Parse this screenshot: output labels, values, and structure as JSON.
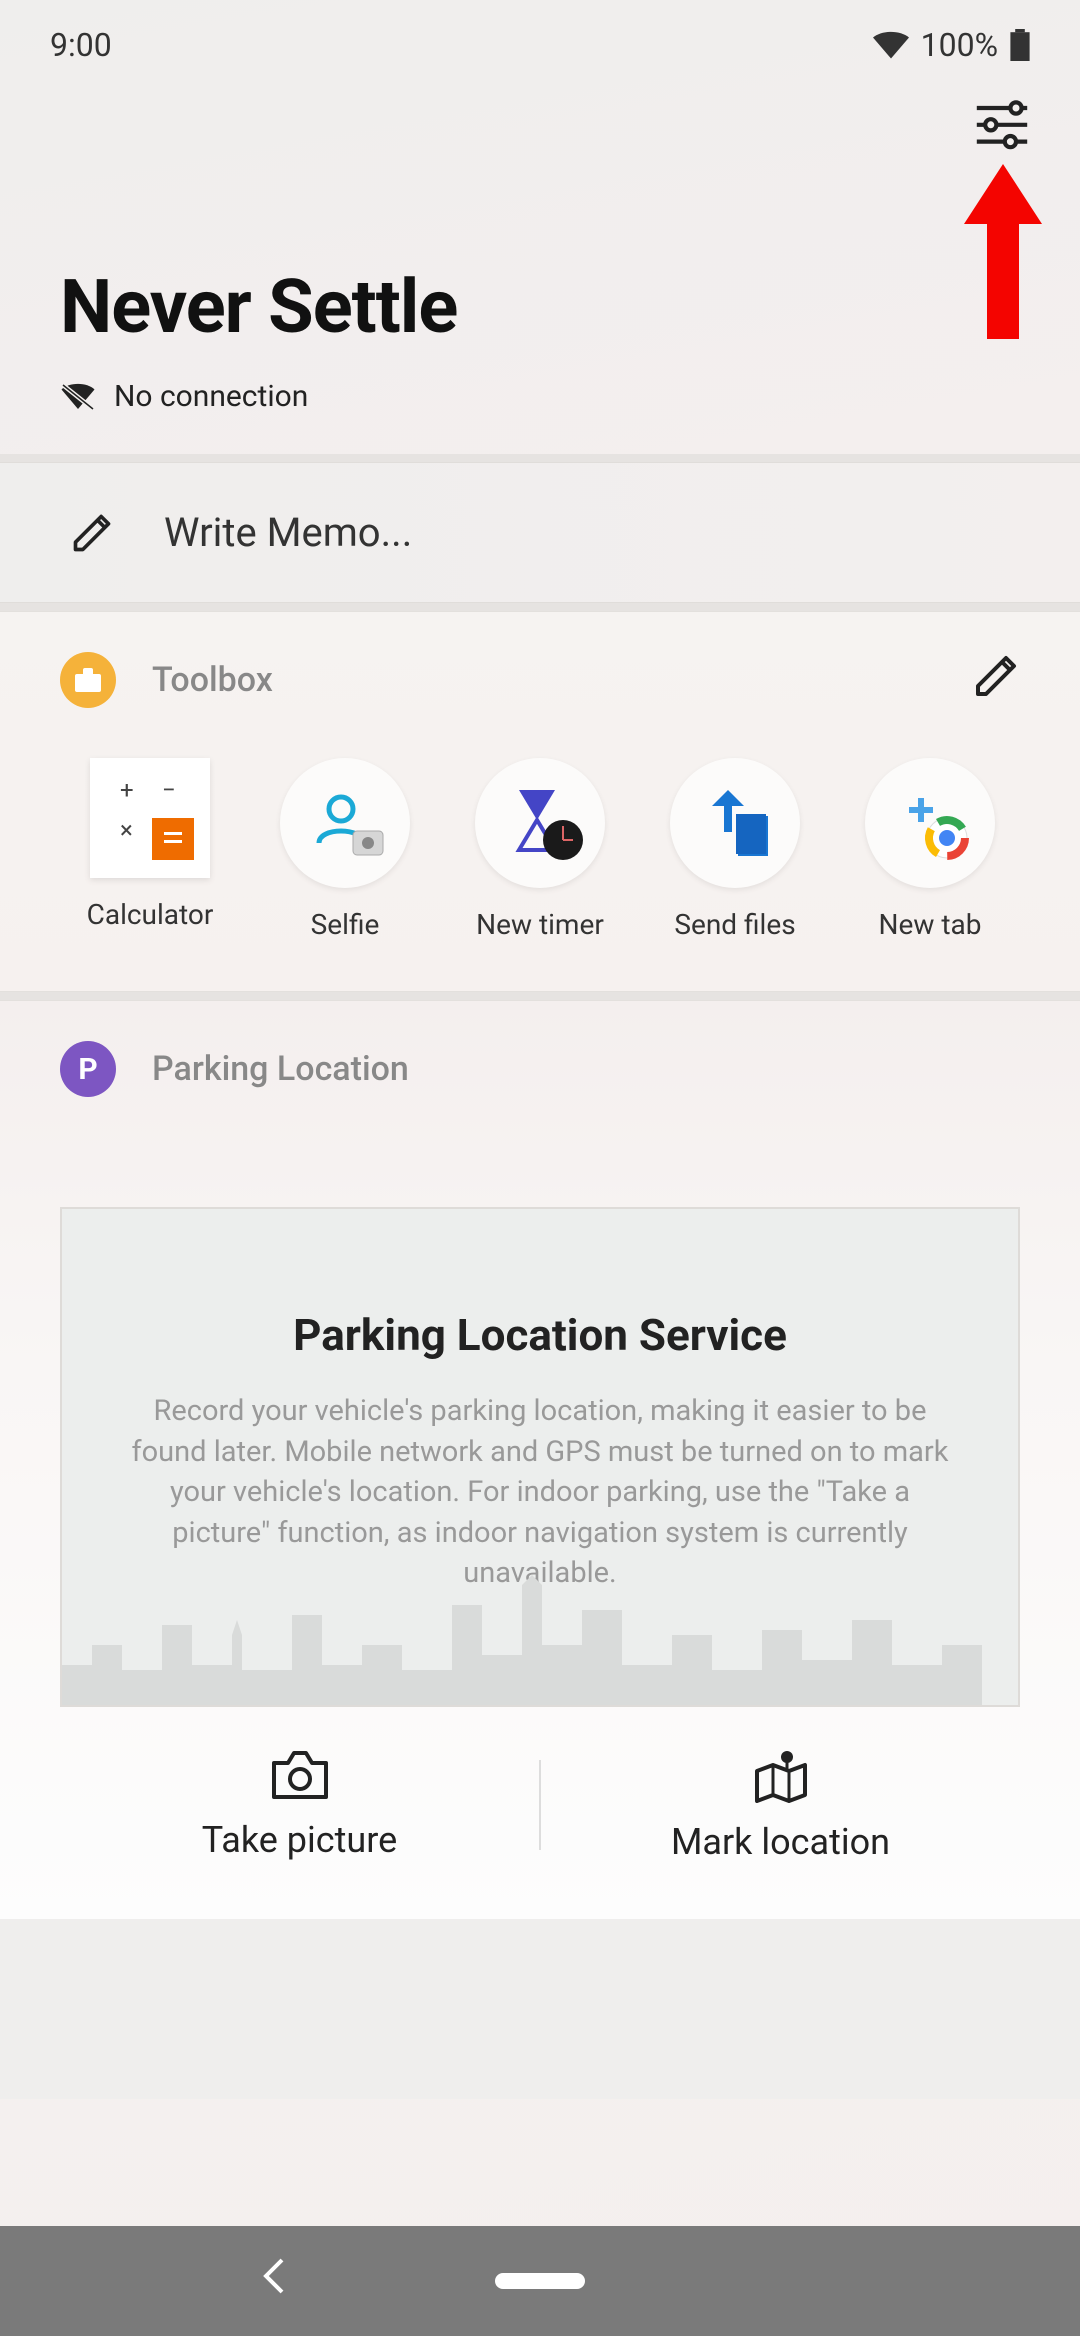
{
  "status": {
    "time": "9:00",
    "battery": "100%"
  },
  "header": {
    "title": "Never Settle",
    "connection": "No connection"
  },
  "memo": {
    "placeholder": "Write Memo..."
  },
  "toolbox": {
    "title": "Toolbox",
    "items": [
      {
        "label": "Calculator"
      },
      {
        "label": "Selfie"
      },
      {
        "label": "New timer"
      },
      {
        "label": "Send files"
      },
      {
        "label": "New tab"
      }
    ]
  },
  "parking": {
    "section_title": "Parking Location",
    "badge_letter": "P",
    "card_title": "Parking Location Service",
    "description": "Record your vehicle's parking location, making it easier to be found later. Mobile network and GPS must be turned on to mark your vehicle's location. For indoor parking, use the \"Take a picture\" function, as indoor navigation system is currently unavailable.",
    "actions": {
      "take_picture": "Take picture",
      "mark_location": "Mark location"
    }
  }
}
